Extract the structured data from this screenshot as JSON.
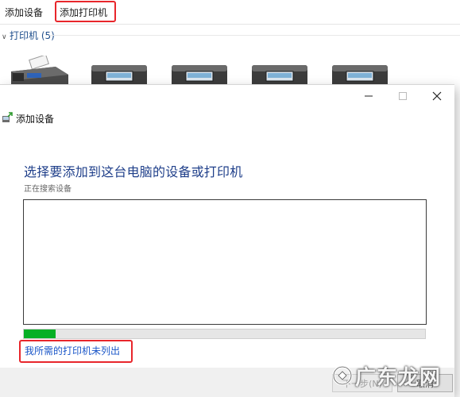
{
  "toolbar": {
    "add_device": "添加设备",
    "add_printer": "添加打印机"
  },
  "section": {
    "label": "打印机 (5)"
  },
  "dialog": {
    "title": "添加设备",
    "heading": "选择要添加到这台电脑的设备或打印机",
    "status": "正在搜索设备",
    "progress_fraction": 0.08,
    "link": "我所需的打印机未列出",
    "next_button": "下一步(N)",
    "cancel_button": "取消"
  },
  "watermark": {
    "text": "广东龙网"
  },
  "colors": {
    "highlight_red": "#e8262b",
    "heading_blue": "#1f3f8a",
    "link_blue": "#1a56c8",
    "progress_green": "#06b025"
  }
}
